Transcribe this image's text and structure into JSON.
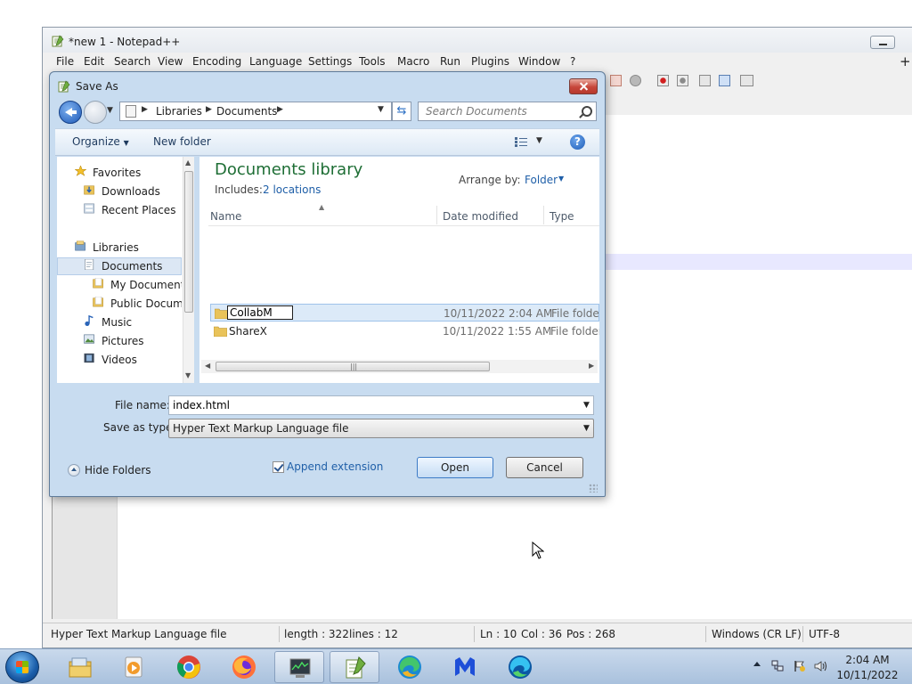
{
  "npp": {
    "title": "*new 1 - Notepad++",
    "menu": [
      "File",
      "Edit",
      "Search",
      "View",
      "Encoding",
      "Language",
      "Settings",
      "Tools",
      "Macro",
      "Run",
      "Plugins",
      "Window",
      "?"
    ],
    "menu_plus": "+",
    "status": {
      "filetype": "Hyper Text Markup Language file",
      "length": "length : 322",
      "lines": "lines : 12",
      "ln": "Ln : 10",
      "col": "Col : 36",
      "pos": "Pos : 268",
      "eol": "Windows (CR LF)",
      "encoding": "UTF-8"
    }
  },
  "dialog": {
    "title": "Save As",
    "breadcrumb": [
      "Libraries",
      "Documents"
    ],
    "search_placeholder": "Search Documents",
    "organize_label": "Organize",
    "new_folder_label": "New folder",
    "nav": {
      "favorites": "Favorites",
      "downloads": "Downloads",
      "recent_places": "Recent Places",
      "libraries": "Libraries",
      "documents": "Documents",
      "my_documents": "My Documents",
      "public_documents": "Public Documents",
      "music": "Music",
      "pictures": "Pictures",
      "videos": "Videos"
    },
    "library_title": "Documents library",
    "includes_label": "Includes:",
    "includes_link": "2 locations",
    "arrange_label": "Arrange by:",
    "arrange_value": "Folder",
    "columns": [
      "Name",
      "Date modified",
      "Type"
    ],
    "files": [
      {
        "name": "CollabM",
        "date": "10/11/2022 2:04 AM",
        "type": "File folder",
        "renaming": true
      },
      {
        "name": "ShareX",
        "date": "10/11/2022 1:55 AM",
        "type": "File folder"
      }
    ],
    "file_name_label": "File name:",
    "file_name_value": "index.html",
    "save_type_label": "Save as type:",
    "save_type_value": "Hyper Text Markup Language file",
    "hide_folders_label": "Hide Folders",
    "append_extension_label": "Append extension",
    "append_extension_checked": true,
    "open_label": "Open",
    "cancel_label": "Cancel"
  },
  "taskbar": {
    "time": "2:04 AM",
    "date": "10/11/2022",
    "apps": [
      "file-explorer",
      "media-player",
      "chrome",
      "firefox",
      "task-manager",
      "notepad-plus-plus",
      "edge-canary",
      "malwarebytes",
      "edge"
    ]
  },
  "colors": {
    "library_title": "#1e6e35",
    "link": "#1f5fa8",
    "selection": "#dceaf8",
    "current_line": "#e8e8ff"
  }
}
